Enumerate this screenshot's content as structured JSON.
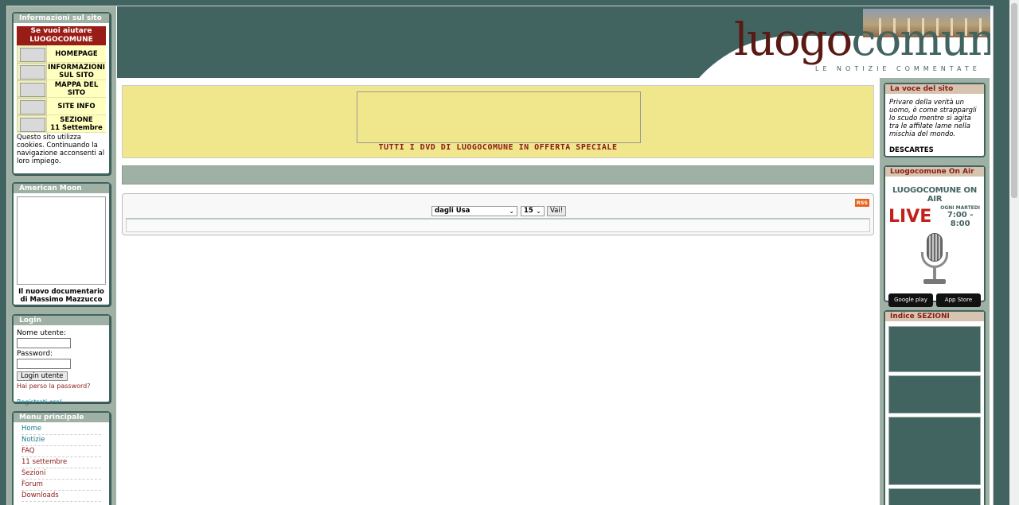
{
  "left": {
    "info_title": "Informazioni sul sito",
    "help_header": "Se vuoi aiutare\nLUOGOCOMUNE",
    "help_items": [
      "HOMEPAGE",
      "INFORMAZIONI\nSUL SITO",
      "MAPPA DEL\nSITO",
      "SITE INFO",
      "SEZIONE\n11 Settembre"
    ],
    "cookie_text": "Questo sito utilizza cookies. Continuando la navigazione acconsenti al loro impiego.",
    "moon_title": "American Moon",
    "moon_caption": "Il nuovo documentario\ndi Massimo Mazzucco",
    "login_title": "Login",
    "username_label": "Nome utente:",
    "password_label": "Password:",
    "login_button": "Login utente",
    "lost_password": "Hai perso la password?",
    "register": "Registrati ora!",
    "menu_title": "Menu principale",
    "menu_items": [
      "Home",
      "Notizie",
      "FAQ",
      "11 settembre",
      "Sezioni",
      "Forum",
      "Downloads"
    ]
  },
  "header": {
    "logo_part1": "luogo",
    "logo_part2": "comune",
    "tagline": "LE NOTIZIE COMMENTATE"
  },
  "main": {
    "banner_text": "TUTTI I DVD DI LUOGOCOMUNE IN OFFERTA SPECIALE",
    "rss": "RSS",
    "select_value": "dagli Usa",
    "count_value": "15",
    "go_button": "Vai!"
  },
  "right": {
    "voice_title": "La voce del sito",
    "quote": "Privare della verità un uomo, è come strappargli lo scudo mentre si agita tra le affilate lame nella mischia del mondo.",
    "author": "DESCARTES",
    "onair_title": "Luogocomune On Air",
    "onair_heading": "LUOGOCOMUNE ON AIR",
    "live": "LIVE",
    "live_day": "OGNI MARTEDI",
    "live_time": "7:00 - 8:00",
    "google_play": "Google play",
    "app_store": "App Store",
    "index_title": "Indice SEZIONI"
  }
}
